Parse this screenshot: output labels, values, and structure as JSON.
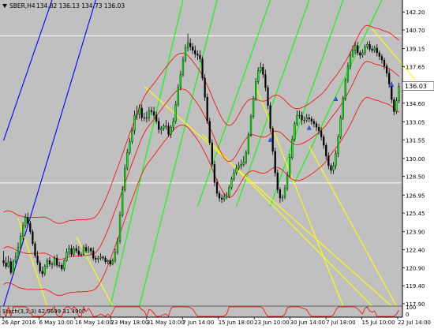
{
  "window": {
    "title": "SBER,H4",
    "ohlc_text": "134.82 136.13 134.73 136.03"
  },
  "chart_data": {
    "type": "candlestick",
    "symbol": "SBER",
    "timeframe": "H4",
    "ohlc": {
      "open": 134.82,
      "high": 136.13,
      "low": 134.73,
      "close": 136.03
    },
    "current_price": 136.03,
    "price_axis": {
      "ylim": [
        117.7,
        143.2
      ],
      "tick_labels": [
        "142.20",
        "140.70",
        "139.15",
        "137.65",
        "136.10",
        "134.60",
        "133.05",
        "131.55",
        "130.00",
        "128.50",
        "126.95",
        "125.45",
        "123.90",
        "122.40",
        "120.90",
        "119.40",
        "117.90"
      ]
    },
    "horizontal_levels": [
      {
        "value": 140.23,
        "color": "#ffffff"
      },
      {
        "value": 127.96,
        "color": "#ffffff"
      }
    ],
    "time_axis": {
      "tick_labels": [
        "26 Apr 2016",
        "6 May 10:00",
        "16 May 14:00",
        "23 May 18:00",
        "31 May 10:00",
        "7 Jun 14:00",
        "15 Jun 18:00",
        "23 Jun 10:00",
        "30 Jun 14:00",
        "7 Jul 18:00",
        "15 Jul 10:00",
        "22 Jul 14:00"
      ]
    },
    "indicator": {
      "label": "Stoch(3,3,3) 62.9699 31.4907",
      "scale_labels": [
        "100",
        "0"
      ]
    },
    "series_colors": {
      "background": "#c0c0c0",
      "candle": "#000000",
      "bullish_body": "#00ff00",
      "envelope": "#ff0000",
      "green_lines": "#00ff00",
      "yellow_lines": "#ffff00",
      "blue_lines": "#0000ff",
      "price_box": "#ffffff"
    },
    "candles": [
      [
        121.5,
        121.3,
        122.3,
        121.0
      ],
      [
        121.3,
        121.0,
        121.8,
        120.8
      ],
      [
        121.0,
        121.4,
        121.9,
        120.9
      ],
      [
        121.4,
        120.5,
        121.7,
        120.3
      ],
      [
        120.5,
        121.4,
        121.6,
        120.3
      ],
      [
        121.4,
        121.8,
        122.2,
        121.2
      ],
      [
        121.8,
        122.6,
        123.0,
        121.6
      ],
      [
        122.6,
        123.5,
        123.8,
        122.4
      ],
      [
        123.5,
        124.4,
        124.7,
        123.2
      ],
      [
        124.4,
        125.1,
        125.4,
        124.2
      ],
      [
        125.1,
        124.6,
        125.5,
        124.4
      ],
      [
        124.6,
        123.9,
        124.8,
        123.7
      ],
      [
        123.9,
        122.9,
        124.1,
        122.7
      ],
      [
        122.9,
        121.9,
        123.1,
        121.7
      ],
      [
        121.9,
        121.3,
        122.3,
        121.1
      ],
      [
        121.3,
        120.6,
        121.5,
        120.4
      ],
      [
        120.6,
        120.4,
        121.0,
        120.1
      ],
      [
        120.4,
        121.0,
        121.2,
        120.2
      ],
      [
        121.0,
        121.5,
        121.7,
        120.8
      ],
      [
        121.5,
        121.2,
        121.8,
        121.0
      ],
      [
        121.2,
        121.2,
        121.4,
        120.8
      ],
      [
        121.2,
        121.7,
        121.9,
        121.0
      ],
      [
        121.7,
        121.1,
        122.0,
        120.9
      ],
      [
        121.1,
        121.1,
        121.4,
        120.9
      ],
      [
        121.1,
        120.8,
        121.3,
        120.6
      ],
      [
        120.8,
        121.5,
        121.6,
        120.6
      ],
      [
        121.5,
        122.2,
        122.5,
        121.4
      ],
      [
        122.2,
        122.5,
        122.8,
        121.9
      ],
      [
        122.5,
        122.0,
        122.8,
        121.8
      ],
      [
        122.0,
        122.5,
        122.7,
        121.8
      ],
      [
        122.5,
        122.3,
        122.8,
        122.1
      ],
      [
        122.3,
        122.0,
        122.7,
        121.8
      ],
      [
        122.0,
        122.0,
        122.2,
        121.8
      ],
      [
        122.0,
        122.6,
        122.8,
        121.9
      ],
      [
        122.6,
        122.3,
        122.9,
        122.1
      ],
      [
        122.3,
        122.5,
        122.7,
        122.1
      ],
      [
        122.5,
        122.3,
        122.6,
        122.0
      ],
      [
        122.3,
        121.7,
        122.6,
        121.5
      ],
      [
        121.7,
        121.6,
        121.9,
        121.3
      ],
      [
        121.6,
        121.7,
        121.9,
        121.3
      ],
      [
        121.7,
        121.8,
        122.1,
        121.5
      ],
      [
        121.8,
        121.7,
        121.9,
        121.5
      ],
      [
        121.7,
        121.4,
        121.9,
        121.2
      ],
      [
        121.4,
        121.5,
        121.6,
        121.2
      ],
      [
        121.5,
        121.2,
        121.6,
        121.0
      ],
      [
        121.2,
        121.5,
        121.7,
        121.1
      ],
      [
        121.5,
        122.2,
        122.5,
        121.3
      ],
      [
        122.2,
        123.1,
        123.4,
        122.0
      ],
      [
        123.1,
        125.3,
        125.6,
        122.9
      ],
      [
        125.3,
        127.4,
        127.7,
        125.1
      ],
      [
        127.4,
        129.2,
        129.5,
        127.2
      ],
      [
        129.2,
        130.5,
        130.8,
        129.0
      ],
      [
        130.5,
        131.4,
        131.7,
        130.3
      ],
      [
        131.4,
        132.3,
        132.6,
        131.2
      ],
      [
        132.3,
        133.6,
        134.0,
        132.0
      ],
      [
        133.6,
        133.7,
        134.4,
        133.2
      ],
      [
        133.7,
        134.2,
        134.5,
        133.3
      ],
      [
        134.2,
        133.4,
        134.5,
        133.1
      ],
      [
        133.4,
        133.4,
        133.8,
        133.1
      ],
      [
        133.4,
        133.4,
        133.9,
        133.0
      ],
      [
        133.4,
        134.0,
        134.3,
        133.1
      ],
      [
        134.0,
        133.9,
        134.3,
        133.6
      ],
      [
        133.9,
        133.6,
        134.3,
        133.3
      ],
      [
        133.6,
        133.1,
        133.9,
        132.9
      ],
      [
        133.1,
        132.4,
        133.4,
        132.1
      ],
      [
        132.4,
        132.5,
        132.7,
        132.0
      ],
      [
        132.5,
        132.7,
        132.9,
        132.3
      ],
      [
        132.7,
        132.7,
        133.2,
        132.4
      ],
      [
        132.7,
        132.0,
        133.0,
        131.8
      ],
      [
        132.0,
        132.6,
        132.8,
        131.7
      ],
      [
        132.6,
        133.1,
        133.4,
        132.3
      ],
      [
        133.1,
        134.5,
        134.8,
        132.9
      ],
      [
        134.5,
        135.9,
        136.2,
        134.3
      ],
      [
        135.9,
        137.0,
        137.3,
        135.7
      ],
      [
        137.0,
        138.2,
        138.5,
        136.8
      ],
      [
        138.2,
        139.2,
        139.5,
        138.0
      ],
      [
        139.2,
        139.6,
        140.4,
        138.9
      ],
      [
        139.6,
        139.3,
        140.0,
        139.0
      ],
      [
        139.3,
        139.0,
        139.6,
        138.7
      ],
      [
        139.0,
        138.7,
        139.4,
        138.4
      ],
      [
        138.7,
        138.6,
        139.0,
        138.2
      ],
      [
        138.6,
        138.3,
        139.0,
        138.0
      ],
      [
        138.3,
        136.7,
        138.5,
        136.5
      ],
      [
        136.7,
        135.1,
        137.0,
        134.8
      ],
      [
        135.1,
        133.1,
        135.4,
        132.9
      ],
      [
        133.1,
        131.3,
        133.4,
        131.1
      ],
      [
        131.3,
        129.5,
        131.6,
        129.3
      ],
      [
        129.5,
        128.0,
        129.8,
        127.7
      ],
      [
        128.0,
        127.1,
        128.3,
        126.8
      ],
      [
        127.1,
        126.7,
        127.3,
        126.4
      ],
      [
        126.7,
        126.6,
        127.0,
        126.3
      ],
      [
        126.6,
        126.8,
        127.1,
        126.4
      ],
      [
        126.8,
        126.9,
        127.2,
        126.6
      ],
      [
        126.9,
        127.6,
        127.8,
        126.7
      ],
      [
        127.6,
        128.3,
        128.5,
        127.4
      ],
      [
        128.3,
        128.8,
        129.1,
        128.1
      ],
      [
        128.8,
        129.2,
        129.5,
        128.6
      ],
      [
        129.2,
        129.4,
        129.7,
        129.0
      ],
      [
        129.4,
        129.5,
        129.9,
        129.1
      ],
      [
        129.5,
        129.7,
        130.2,
        129.3
      ],
      [
        129.7,
        130.5,
        130.7,
        129.5
      ],
      [
        130.5,
        132.0,
        132.2,
        130.3
      ],
      [
        132.0,
        133.5,
        133.7,
        131.8
      ],
      [
        133.5,
        135.0,
        135.2,
        133.3
      ],
      [
        135.0,
        136.4,
        136.7,
        134.8
      ],
      [
        136.4,
        137.3,
        137.6,
        136.2
      ],
      [
        137.3,
        137.6,
        138.0,
        137.1
      ],
      [
        137.6,
        137.0,
        137.9,
        136.7
      ],
      [
        137.0,
        135.9,
        137.4,
        135.6
      ],
      [
        135.9,
        134.4,
        136.1,
        134.1
      ],
      [
        134.4,
        132.5,
        134.7,
        132.2
      ],
      [
        132.5,
        130.6,
        132.7,
        130.3
      ],
      [
        130.6,
        128.8,
        130.9,
        128.5
      ],
      [
        128.8,
        127.4,
        129.1,
        127.1
      ],
      [
        127.4,
        126.7,
        127.6,
        126.3
      ],
      [
        126.7,
        126.8,
        127.0,
        126.4
      ],
      [
        126.8,
        127.5,
        127.8,
        126.6
      ],
      [
        127.5,
        128.6,
        128.9,
        127.3
      ],
      [
        128.6,
        130.1,
        130.4,
        128.4
      ],
      [
        130.1,
        131.6,
        131.9,
        129.9
      ],
      [
        131.6,
        132.9,
        133.1,
        131.4
      ],
      [
        132.9,
        133.6,
        134.0,
        132.7
      ],
      [
        133.6,
        133.6,
        134.0,
        133.3
      ],
      [
        133.6,
        133.2,
        133.9,
        132.8
      ],
      [
        133.2,
        133.2,
        133.5,
        132.9
      ],
      [
        133.2,
        133.4,
        133.7,
        133.0
      ],
      [
        133.4,
        133.3,
        133.7,
        133.0
      ],
      [
        133.3,
        133.1,
        133.5,
        132.8
      ],
      [
        133.1,
        132.9,
        133.3,
        132.6
      ],
      [
        132.9,
        132.6,
        133.1,
        132.3
      ],
      [
        132.6,
        132.3,
        132.9,
        132.0
      ],
      [
        132.3,
        131.8,
        132.6,
        131.5
      ],
      [
        131.8,
        131.1,
        132.0,
        130.8
      ],
      [
        131.1,
        130.2,
        131.3,
        129.9
      ],
      [
        130.2,
        129.4,
        130.5,
        129.1
      ],
      [
        129.4,
        129.0,
        129.6,
        128.7
      ],
      [
        129.0,
        129.4,
        129.7,
        128.7
      ],
      [
        129.4,
        130.4,
        130.7,
        129.1
      ],
      [
        130.4,
        131.8,
        132.0,
        130.1
      ],
      [
        131.8,
        133.4,
        133.6,
        131.6
      ],
      [
        133.4,
        135.0,
        135.2,
        133.2
      ],
      [
        135.0,
        136.5,
        136.7,
        134.8
      ],
      [
        136.5,
        137.7,
        138.0,
        136.3
      ],
      [
        137.7,
        138.6,
        138.9,
        137.4
      ],
      [
        138.6,
        139.0,
        139.4,
        138.4
      ],
      [
        139.0,
        139.4,
        139.7,
        138.7
      ],
      [
        139.4,
        138.8,
        139.7,
        138.6
      ],
      [
        138.8,
        138.6,
        139.0,
        138.3
      ],
      [
        138.6,
        138.8,
        139.1,
        138.4
      ],
      [
        138.8,
        139.3,
        139.5,
        138.6
      ],
      [
        139.3,
        139.5,
        139.7,
        139.1
      ],
      [
        139.5,
        139.1,
        139.8,
        138.9
      ],
      [
        139.1,
        139.0,
        139.4,
        138.8
      ],
      [
        139.0,
        139.2,
        139.4,
        138.8
      ],
      [
        139.2,
        138.8,
        139.5,
        138.5
      ],
      [
        138.8,
        138.5,
        139.0,
        138.2
      ],
      [
        138.5,
        138.2,
        138.7,
        137.9
      ],
      [
        138.2,
        137.7,
        138.4,
        137.4
      ],
      [
        137.7,
        137.1,
        137.9,
        136.8
      ],
      [
        137.1,
        136.2,
        137.4,
        135.9
      ],
      [
        136.2,
        134.9,
        136.4,
        134.6
      ],
      [
        134.9,
        133.9,
        135.1,
        133.6
      ],
      [
        133.9,
        134.8,
        135.1,
        133.7
      ],
      [
        134.8,
        136.0,
        136.3,
        134.6
      ]
    ]
  }
}
